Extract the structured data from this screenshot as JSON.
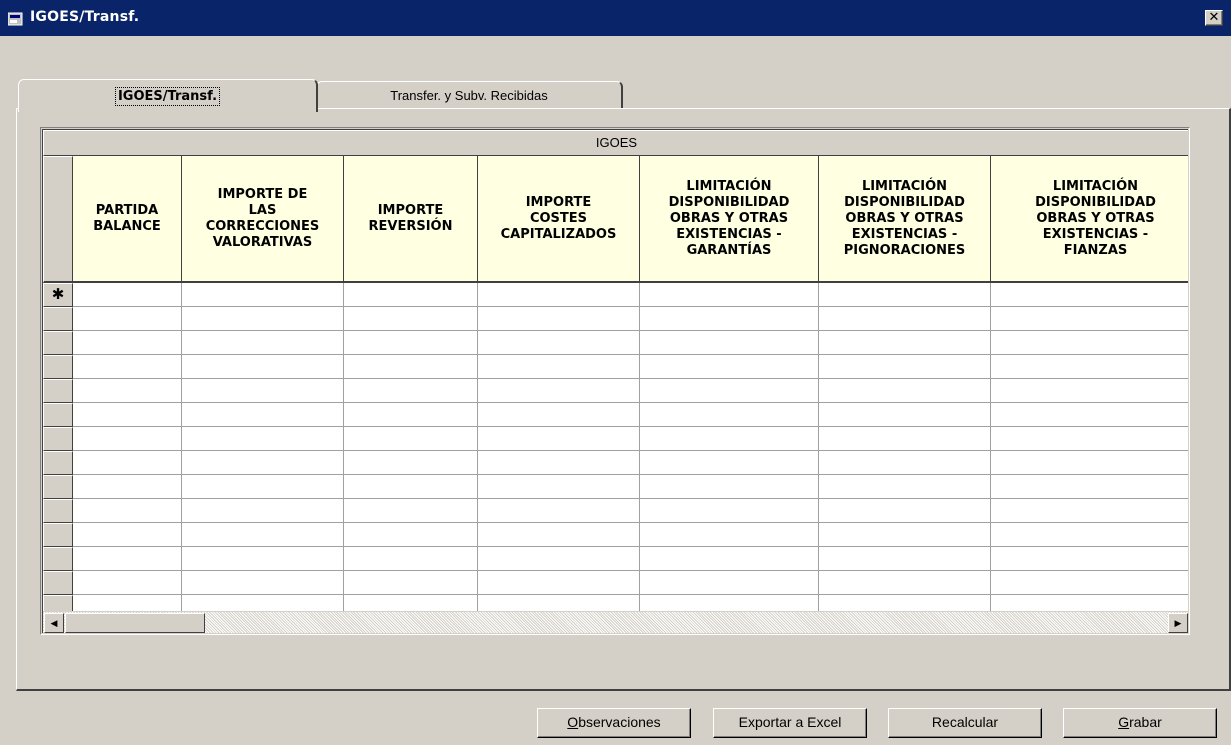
{
  "window": {
    "title": "IGOES/Transf.",
    "close_label": "✕"
  },
  "tabs": [
    {
      "label": "IGOES/Transf.",
      "active": true
    },
    {
      "label": "Transfer. y Subv. Recibidas",
      "active": false
    }
  ],
  "grid": {
    "band_header": "IGOES",
    "columns": [
      "PARTIDA\nBALANCE",
      "IMPORTE DE\nLAS\nCORRECCIONES\nVALORATIVAS",
      "IMPORTE\nREVERSIÓN",
      "IMPORTE\nCOSTES\nCAPITALIZADOS",
      "LIMITACIÓN\nDISPONIBILIDAD\nOBRAS Y OTRAS\nEXISTENCIAS -\nGARANTÍAS",
      "LIMITACIÓN\nDISPONIBILIDAD\nOBRAS Y OTRAS\nEXISTENCIAS -\nPIGNORACIONES",
      "LIMITACIÓN\nDISPONIBILIDAD\nOBRAS Y OTRAS\nEXISTENCIAS -\nFIANZAS"
    ],
    "new_row_marker": "✱",
    "row_count": 14,
    "scroll_left": "◀",
    "scroll_right": "▶"
  },
  "buttons": {
    "observaciones": {
      "mnemonic": "O",
      "rest": "bservaciones"
    },
    "exportar": "Exportar a Excel",
    "recalcular": "Recalcular",
    "grabar": {
      "mnemonic": "G",
      "rest": "rabar"
    }
  }
}
